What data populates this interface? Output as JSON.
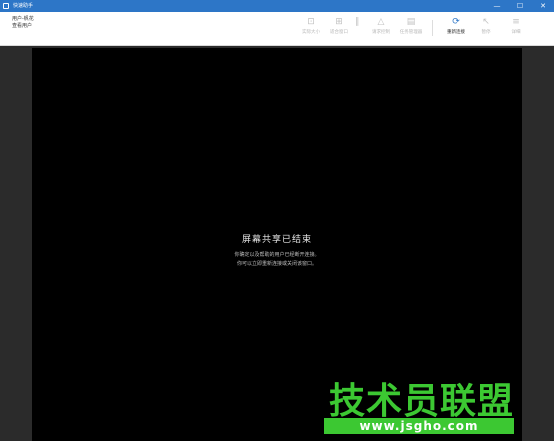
{
  "window": {
    "title": "快速助手",
    "minimize_glyph": "—",
    "maximize_glyph": "☐",
    "close_glyph": "✕"
  },
  "toolbar": {
    "user_line1": "用户-帆花",
    "user_line2": "查看用户",
    "tools": [
      {
        "icon": "restore-icon",
        "glyph": "⊡",
        "label": "实际大小"
      },
      {
        "icon": "fit-icon",
        "glyph": "⊞",
        "label": "适合窗口"
      },
      {
        "icon": "pause-icon",
        "glyph": "∥",
        "label": ""
      },
      {
        "icon": "annotate-icon",
        "glyph": "△",
        "label": "请求控制"
      },
      {
        "icon": "monitor-icon",
        "glyph": "▤",
        "label": "任务管理器"
      },
      {
        "icon": "reconnect-icon",
        "glyph": "⟳",
        "label": "重新连接"
      },
      {
        "icon": "pointer-icon",
        "glyph": "↖",
        "label": "暂停"
      },
      {
        "icon": "menu-icon",
        "glyph": "≡",
        "label": "详细"
      }
    ]
  },
  "content": {
    "message_title": "屏幕共享已结束",
    "message_line1": "你确定以及帮助的用户已经断开连接。",
    "message_line2": "你可以立即重新连接或关闭该窗口。"
  },
  "watermark": {
    "text": "技术员联盟",
    "url": "www.jsgho.com"
  },
  "colors": {
    "titlebar": "#2d76c7",
    "watermark": "#3cc832"
  }
}
